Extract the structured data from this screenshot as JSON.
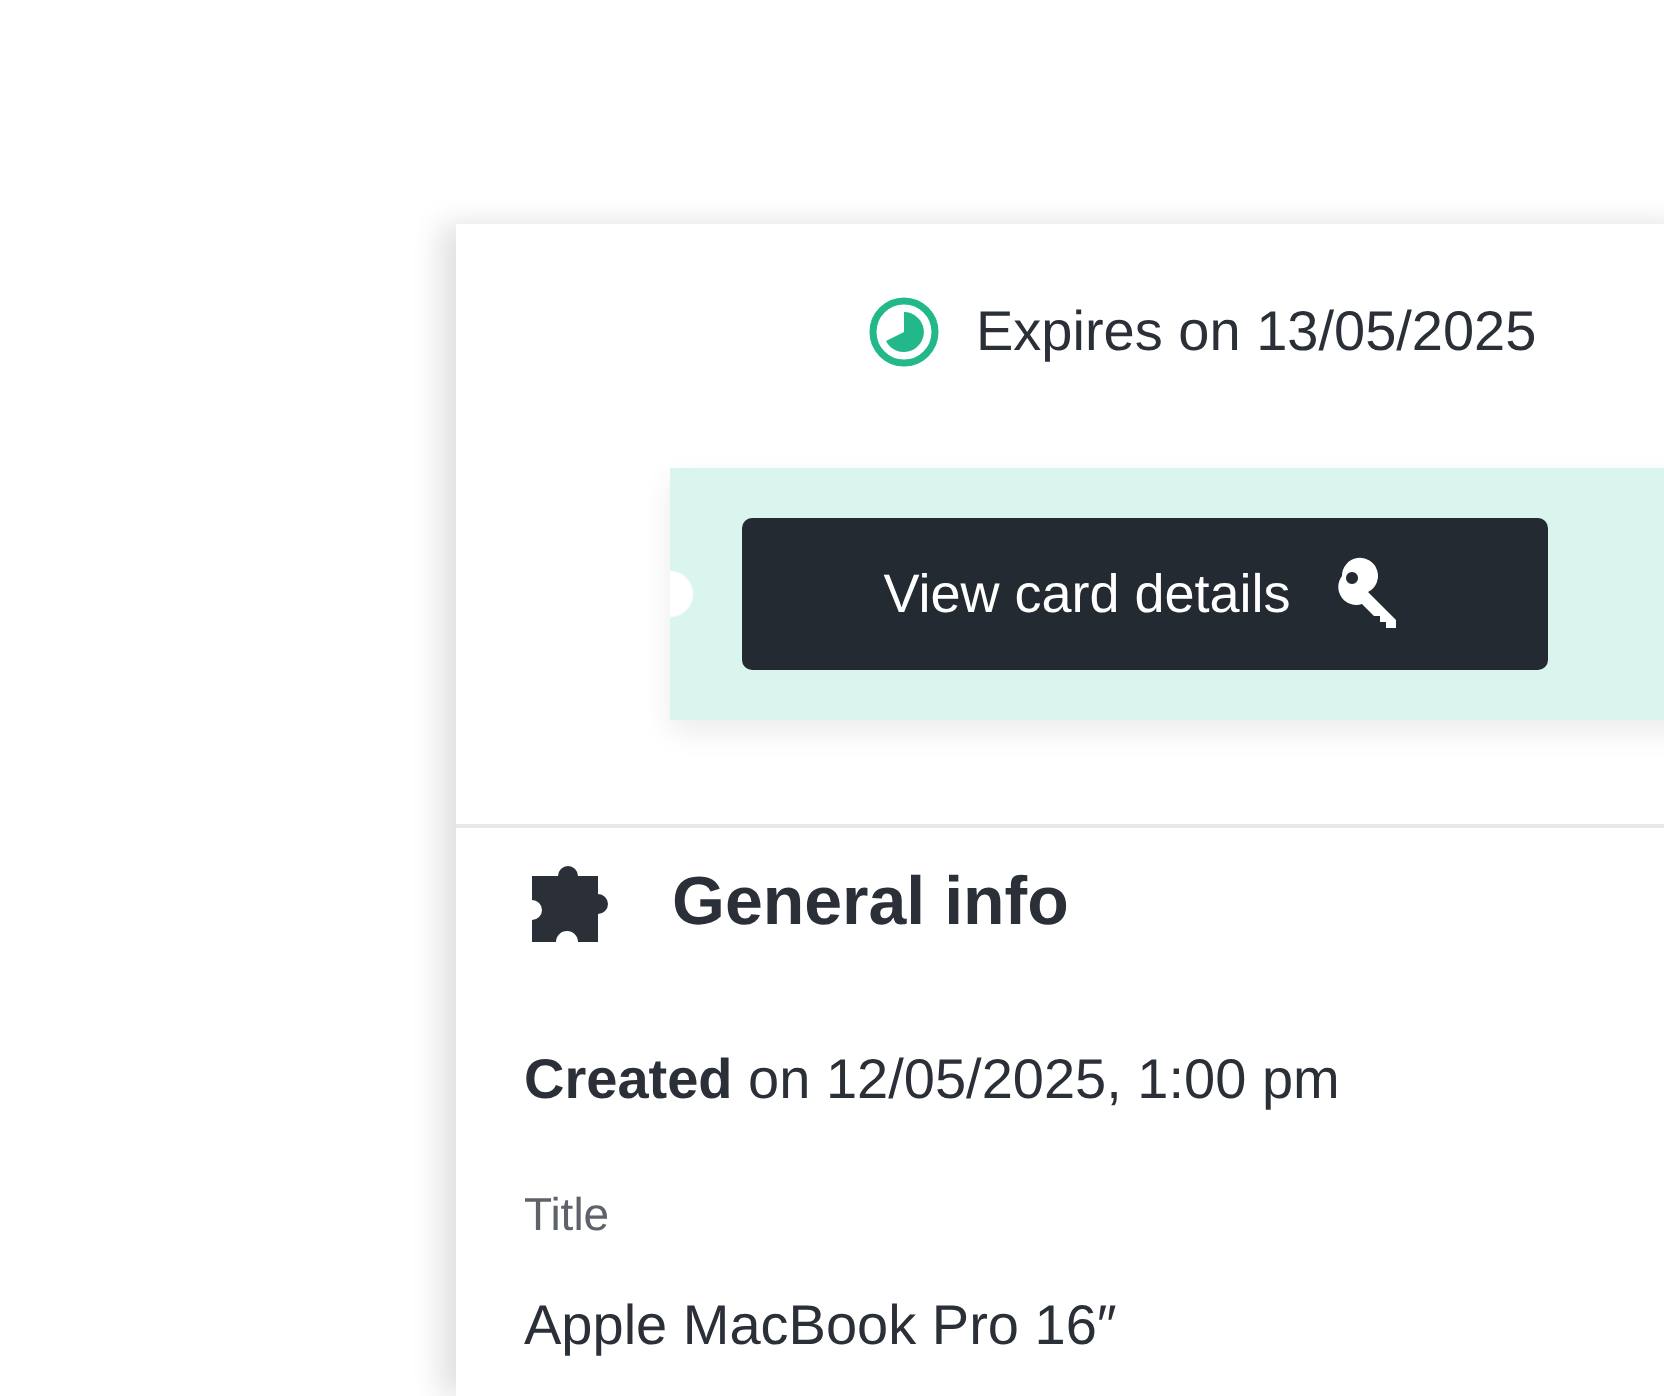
{
  "expiry": {
    "text": "Expires on 13/05/2025"
  },
  "card": {
    "button": "View card details"
  },
  "section": {
    "title": "General info",
    "created": "**Created** on 12/05/2025, 1:00 pm",
    "fields": [
      {
        "label": "Title",
        "value": "Apple MacBook Pro 16″"
      }
    ]
  }
}
